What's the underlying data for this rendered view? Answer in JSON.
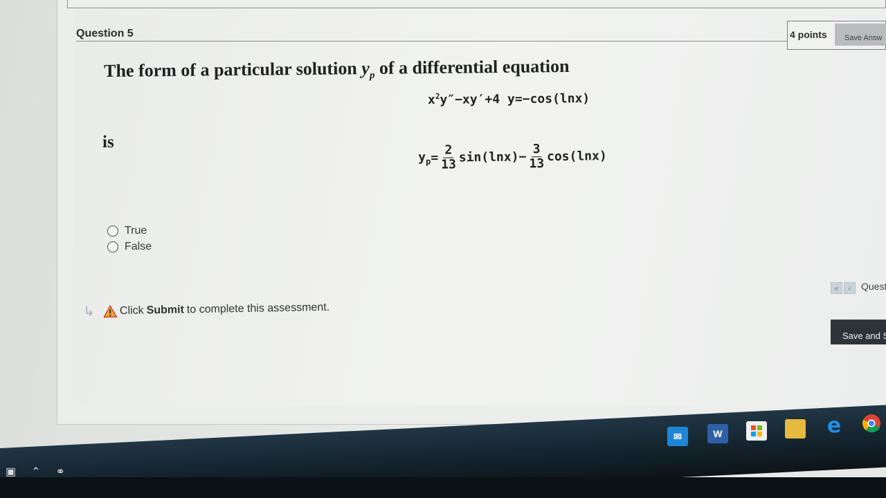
{
  "question": {
    "header": "Question 5",
    "points": "4 points",
    "save_answer_label": "Save Answ",
    "intro_text": "The form of a particular solution",
    "intro_var": "y",
    "intro_sub": "p",
    "intro_tail": "of a differential equation",
    "equation": {
      "part1": "x",
      "part1_sup": "2",
      "part2": "y″−xy′+4 y=−cos(lnx)"
    },
    "is_text": "is",
    "solution": {
      "lhs": "y",
      "lhs_sub": "p",
      "eq": "=",
      "frac1_num": "2",
      "frac1_den": "13",
      "term1": "sin(lnx)−",
      "frac2_num": "3",
      "frac2_den": "13",
      "term2": "cos(lnx)"
    }
  },
  "options": [
    {
      "label": "True"
    },
    {
      "label": "False"
    }
  ],
  "navigation": {
    "first_glyph": "«",
    "prev_glyph": "‹",
    "label": "Quest"
  },
  "submit_notice": {
    "prefix": "Click",
    "bold": "Submit",
    "suffix": "to complete this assessment."
  },
  "save_submit_label": "Save and S",
  "taskbar": {
    "icons": [
      "mail-icon",
      "word-icon",
      "store-icon",
      "file-explorer-icon",
      "edge-icon",
      "chrome-icon"
    ],
    "word_letter": "W",
    "edge_letter": "e"
  }
}
